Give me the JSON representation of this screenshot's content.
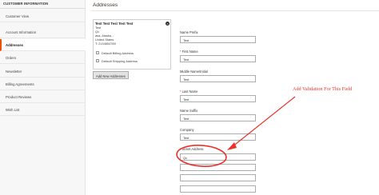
{
  "sidebar": {
    "title": "CUSTOMER INFORMATION",
    "items": [
      {
        "label": "Customer View"
      },
      {
        "label": "Account Information"
      },
      {
        "label": "Addresses"
      },
      {
        "label": "Orders"
      },
      {
        "label": "Newsletter"
      },
      {
        "label": "Billing Agreements"
      },
      {
        "label": "Product Reviews"
      },
      {
        "label": "Wish List"
      }
    ]
  },
  "main": {
    "title": "Addresses"
  },
  "address_card": {
    "name": "Test Test Test Test Test",
    "lines": [
      "Test",
      "Qx",
      "asa, Alaska, -",
      "United States",
      "T: 2134654789"
    ],
    "default_billing": "Default Billing Address",
    "default_shipping": "Default Shipping Address",
    "delete_icon": "close-icon"
  },
  "add_button": "Add New Addresses",
  "form": {
    "name_prefix": {
      "label": "Name Prefix",
      "value": "Test"
    },
    "first_name": {
      "label": "First Name",
      "value": "Test"
    },
    "middle_name": {
      "label": "Middle Name/Initial",
      "value": "Test"
    },
    "last_name": {
      "label": "Last Name",
      "value": "Test"
    },
    "name_suffix": {
      "label": "Name Suffix",
      "value": "Test"
    },
    "company": {
      "label": "Company",
      "value": "Test"
    },
    "street_address": {
      "label": "Street Address",
      "line1": "Qx",
      "line2": "",
      "line3": ""
    }
  },
  "annotation": {
    "text": "Add Validation For This Field",
    "color": "#e8322b"
  },
  "colors": {
    "accent": "#eb5202",
    "annotation": "#e8322b"
  }
}
